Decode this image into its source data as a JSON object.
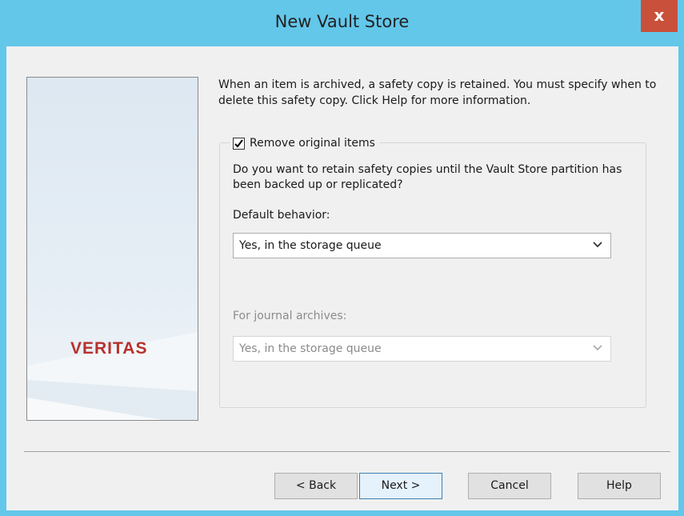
{
  "window": {
    "title": "New Vault Store",
    "close_label": "x"
  },
  "side_panel": {
    "logo_text": "VERITAS",
    "logo_color": "#b7312c"
  },
  "intro_text": "When an item is archived, a safety copy is retained. You must specify when to delete this safety copy. Click Help for more information.",
  "group": {
    "checkbox_label": "Remove original items",
    "checkbox_checked": true,
    "question": "Do you want to retain safety copies until the Vault Store partition has been backed up or replicated?",
    "default_label": "Default behavior:",
    "default_value": "Yes, in the storage queue",
    "journal_label": "For journal archives:",
    "journal_value": "Yes, in the storage queue",
    "journal_enabled": false
  },
  "buttons": {
    "back": "< Back",
    "next": "Next >",
    "cancel": "Cancel",
    "help": "Help"
  },
  "colors": {
    "titlebar": "#63c7ea",
    "close": "#c9503b",
    "default_button_border": "#3c7fb1"
  }
}
